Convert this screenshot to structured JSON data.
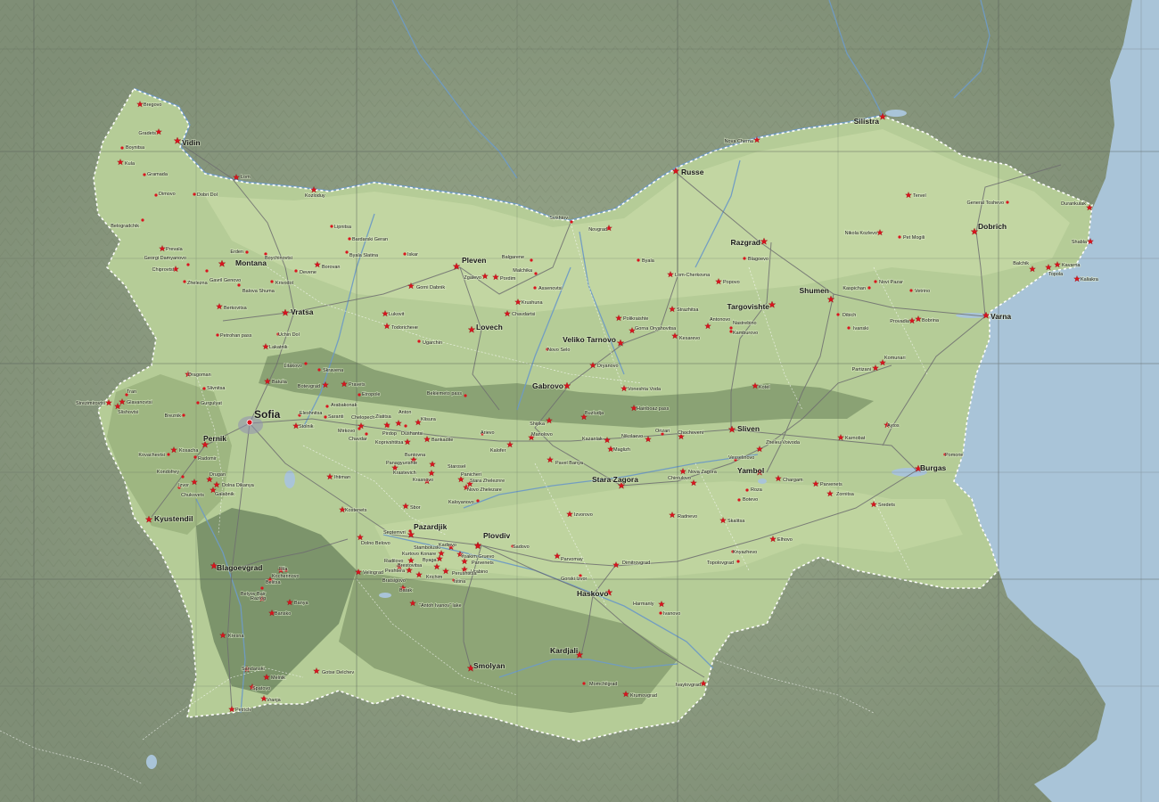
{
  "map": {
    "colors": {
      "sea": "#a9c4d8",
      "land_outside": "#8d9a82",
      "country_lowland": "#b9cf9c",
      "country_mid": "#a9c28a",
      "country_hill": "#93ad78",
      "mountain": "#7c9468",
      "river": "#6f9bc4",
      "road": "#6e6e70",
      "border": "#ffffff",
      "grid": "#555555",
      "star": "#d9141e"
    },
    "places": [
      {
        "name": "Bregovo",
        "kind": "marker"
      },
      {
        "name": "Gradets",
        "kind": "marker"
      },
      {
        "name": "Vidin",
        "kind": "city"
      },
      {
        "name": "Boynitsa",
        "kind": "dot"
      },
      {
        "name": "Kula",
        "kind": "marker"
      },
      {
        "name": "Gramada",
        "kind": "dot"
      },
      {
        "name": "Dimovo",
        "kind": "dot"
      },
      {
        "name": "Dobri Dol",
        "kind": "dot"
      },
      {
        "name": "Lom",
        "kind": "marker"
      },
      {
        "name": "Kozloduy",
        "kind": "marker"
      },
      {
        "name": "Belogradchik",
        "kind": "dot"
      },
      {
        "name": "Lipnitsa",
        "kind": "dot"
      },
      {
        "name": "Bardarski Geran",
        "kind": "dot"
      },
      {
        "name": "Prevala",
        "kind": "marker"
      },
      {
        "name": "Erden",
        "kind": "dot"
      },
      {
        "name": "Boychinovtsi",
        "kind": "dot"
      },
      {
        "name": "Byala Slatina",
        "kind": "dot"
      },
      {
        "name": "Iskar",
        "kind": "dot"
      },
      {
        "name": "Chiprovtsi",
        "kind": "marker"
      },
      {
        "name": "Georgi Damyanovo",
        "kind": "dot"
      },
      {
        "name": "Zheleznа",
        "kind": "dot"
      },
      {
        "name": "Gavril Genovo",
        "kind": "dot"
      },
      {
        "name": "Montana",
        "kind": "city"
      },
      {
        "name": "Balova Shuma",
        "kind": "dot"
      },
      {
        "name": "Krivodol",
        "kind": "dot"
      },
      {
        "name": "Devene",
        "kind": "dot"
      },
      {
        "name": "Borovan",
        "kind": "marker"
      },
      {
        "name": "Gorni Dabnik",
        "kind": "marker"
      },
      {
        "name": "Pleven",
        "kind": "city"
      },
      {
        "name": "Balgarene",
        "kind": "dot"
      },
      {
        "name": "Malchika",
        "kind": "dot"
      },
      {
        "name": "Zgalevo",
        "kind": "marker"
      },
      {
        "name": "Pordim",
        "kind": "marker"
      },
      {
        "name": "Assenovtsi",
        "kind": "dot"
      },
      {
        "name": "Berkovitsa",
        "kind": "marker"
      },
      {
        "name": "Vratsa",
        "kind": "city"
      },
      {
        "name": "Petrohan pass",
        "kind": "dot"
      },
      {
        "name": "Lukovit",
        "kind": "marker"
      },
      {
        "name": "Todoricheне",
        "kind": "marker"
      },
      {
        "name": "Krushuna",
        "kind": "marker"
      },
      {
        "name": "Chavdartsi",
        "kind": "marker"
      },
      {
        "name": "Lovech",
        "kind": "city"
      },
      {
        "name": "Lakatnik",
        "kind": "marker"
      },
      {
        "name": "Uchin Dol",
        "kind": "dot"
      },
      {
        "name": "Ugarchin",
        "kind": "dot"
      },
      {
        "name": "Svishtov",
        "kind": "dot"
      },
      {
        "name": "Novgrad",
        "kind": "marker"
      },
      {
        "name": "Byala",
        "kind": "dot"
      },
      {
        "name": "Russe",
        "kind": "city"
      },
      {
        "name": "Nova Cherna",
        "kind": "marker"
      },
      {
        "name": "Silistra",
        "kind": "city"
      },
      {
        "name": "Tervel",
        "kind": "marker"
      },
      {
        "name": "General Toshevo",
        "kind": "dot"
      },
      {
        "name": "Durankulak",
        "kind": "marker"
      },
      {
        "name": "Dobrich",
        "kind": "city"
      },
      {
        "name": "Nikola Kozlevo",
        "kind": "marker"
      },
      {
        "name": "Pet Mogili",
        "kind": "dot"
      },
      {
        "name": "Shabla",
        "kind": "marker"
      },
      {
        "name": "Razgrad",
        "kind": "city"
      },
      {
        "name": "Blagoevo",
        "kind": "dot"
      },
      {
        "name": "Lom-Cherkovna",
        "kind": "marker"
      },
      {
        "name": "Popovo",
        "kind": "marker"
      },
      {
        "name": "Kaspichan",
        "kind": "dot"
      },
      {
        "name": "Novi Pazar",
        "kind": "dot"
      },
      {
        "name": "Vetrino",
        "kind": "dot"
      },
      {
        "name": "Balchik",
        "kind": "marker"
      },
      {
        "name": "Kavarna",
        "kind": "marker"
      },
      {
        "name": "Topola",
        "kind": "marker"
      },
      {
        "name": "Kaliakra",
        "kind": "marker"
      },
      {
        "name": "Shumen",
        "kind": "city"
      },
      {
        "name": "Targovishte",
        "kind": "city"
      },
      {
        "name": "Strazhitsa",
        "kind": "marker"
      },
      {
        "name": "Polikraishte",
        "kind": "marker"
      },
      {
        "name": "Gorna Oryahovitsa",
        "kind": "marker"
      },
      {
        "name": "Antonovo",
        "kind": "marker"
      },
      {
        "name": "Kamburovo",
        "kind": "dot"
      },
      {
        "name": "Nastrebino",
        "kind": "dot"
      },
      {
        "name": "Kesarevo",
        "kind": "marker"
      },
      {
        "name": "Dibich",
        "kind": "dot"
      },
      {
        "name": "Ivanski",
        "kind": "dot"
      },
      {
        "name": "Provadia",
        "kind": "marker"
      },
      {
        "name": "Bobrina",
        "kind": "marker"
      },
      {
        "name": "Varna",
        "kind": "city"
      },
      {
        "name": "Novo Selo",
        "kind": "dot"
      },
      {
        "name": "Veliko Tarnovo",
        "kind": "city"
      },
      {
        "name": "Dryanovo",
        "kind": "marker"
      },
      {
        "name": "Partizani",
        "kind": "marker"
      },
      {
        "name": "Komunari",
        "kind": "marker"
      },
      {
        "name": "Dragoman",
        "kind": "marker"
      },
      {
        "name": "Slivnitsa",
        "kind": "dot"
      },
      {
        "name": "Etropole",
        "kind": "dot"
      },
      {
        "name": "Skravena",
        "kind": "dot"
      },
      {
        "name": "Litakovo",
        "kind": "dot"
      },
      {
        "name": "Batulia",
        "kind": "marker"
      },
      {
        "name": "Botevgrad",
        "kind": "marker"
      },
      {
        "name": "Pravets",
        "kind": "marker"
      },
      {
        "name": "Beklemeto pass",
        "kind": "dot"
      },
      {
        "name": "Gabrovo",
        "kind": "city"
      },
      {
        "name": "Voneshta Voda",
        "kind": "marker"
      },
      {
        "name": "Kotel",
        "kind": "marker"
      },
      {
        "name": "Strezimirovtsi",
        "kind": "marker"
      },
      {
        "name": "Tran",
        "kind": "dot"
      },
      {
        "name": "Glavanovtsi",
        "kind": "marker"
      },
      {
        "name": "Slishovtsi",
        "kind": "marker"
      },
      {
        "name": "Gurgulyat",
        "kind": "dot"
      },
      {
        "name": "Breznik",
        "kind": "dot"
      },
      {
        "name": "Sofia",
        "kind": "capital"
      },
      {
        "name": "Elеshnitsa",
        "kind": "dot"
      },
      {
        "name": "Arabakonak",
        "kind": "dot"
      },
      {
        "name": "Saranti",
        "kind": "dot"
      },
      {
        "name": "Stolnik",
        "kind": "marker"
      },
      {
        "name": "Chelopech",
        "kind": "marker"
      },
      {
        "name": "Zlatitsa",
        "kind": "marker"
      },
      {
        "name": "Anton",
        "kind": "marker"
      },
      {
        "name": "Klisura",
        "kind": "marker"
      },
      {
        "name": "Mirkovo",
        "kind": "dot"
      },
      {
        "name": "Chavdar",
        "kind": "dot"
      },
      {
        "name": "Pirdop",
        "kind": "dot"
      },
      {
        "name": "Dushantsi",
        "kind": "dot"
      },
      {
        "name": "Koprivshtitsa",
        "kind": "marker"
      },
      {
        "name": "Barikadite",
        "kind": "marker"
      },
      {
        "name": "Arievo",
        "kind": "dot"
      },
      {
        "name": "Kalofer",
        "kind": "marker"
      },
      {
        "name": "Manolovo",
        "kind": "marker"
      },
      {
        "name": "Shipka",
        "kind": "marker"
      },
      {
        "name": "Buzludja",
        "kind": "marker"
      },
      {
        "name": "Hainboaz pass",
        "kind": "marker"
      },
      {
        "name": "Kazanlak",
        "kind": "marker"
      },
      {
        "name": "Maglizh",
        "kind": "marker"
      },
      {
        "name": "Nikolaevo",
        "kind": "marker"
      },
      {
        "name": "Orizari",
        "kind": "dot"
      },
      {
        "name": "Chochoveni",
        "kind": "marker"
      },
      {
        "name": "Sliven",
        "kind": "city"
      },
      {
        "name": "Pavel Banya",
        "kind": "marker"
      },
      {
        "name": "Karnobat",
        "kind": "marker"
      },
      {
        "name": "Aytos",
        "kind": "marker"
      },
      {
        "name": "Pernik",
        "kind": "city"
      },
      {
        "name": "Kosacha",
        "kind": "marker"
      },
      {
        "name": "Radomir",
        "kind": "dot"
      },
      {
        "name": "Kovachevtsi",
        "kind": "dot"
      },
      {
        "name": "Drugan",
        "kind": "marker"
      },
      {
        "name": "Kondofrey",
        "kind": "dot"
      },
      {
        "name": "Dolna Dikanya",
        "kind": "marker"
      },
      {
        "name": "Izvor",
        "kind": "marker"
      },
      {
        "name": "Galabnik",
        "kind": "marker"
      },
      {
        "name": "Chukovets",
        "kind": "dot"
      },
      {
        "name": "Buntovna",
        "kind": "marker"
      },
      {
        "name": "Panagyurishte",
        "kind": "marker"
      },
      {
        "name": "Staroseł",
        "kind": "marker"
      },
      {
        "name": "Krastevich",
        "kind": "marker"
      },
      {
        "name": "Panicheri",
        "kind": "marker"
      },
      {
        "name": "Krasnovo",
        "kind": "marker"
      },
      {
        "name": "Stara Zheleznre",
        "kind": "marker"
      },
      {
        "name": "Novo Zhelezare",
        "kind": "marker"
      },
      {
        "name": "Ihtiman",
        "kind": "marker"
      },
      {
        "name": "Kaloyanovo",
        "kind": "dot"
      },
      {
        "name": "Kostenets",
        "kind": "marker"
      },
      {
        "name": "Sbor",
        "kind": "marker"
      },
      {
        "name": "Stara Zagora",
        "kind": "city"
      },
      {
        "name": "Chintulovo",
        "kind": "marker"
      },
      {
        "name": "Zheleu Voivoda",
        "kind": "marker"
      },
      {
        "name": "Vesselinovo",
        "kind": "dot"
      },
      {
        "name": "Nova Zagora",
        "kind": "marker"
      },
      {
        "name": "Yambol",
        "kind": "city"
      },
      {
        "name": "Chargam",
        "kind": "marker"
      },
      {
        "name": "Parvenets",
        "kind": "marker"
      },
      {
        "name": "Burgas",
        "kind": "city"
      },
      {
        "name": "Pomorie",
        "kind": "dot"
      },
      {
        "name": "Roza",
        "kind": "dot"
      },
      {
        "name": "Botevo",
        "kind": "dot"
      },
      {
        "name": "Zornitsa",
        "kind": "marker"
      },
      {
        "name": "Sredets",
        "kind": "marker"
      },
      {
        "name": "Kyustendil",
        "kind": "city"
      },
      {
        "name": "Izvorovo",
        "kind": "marker"
      },
      {
        "name": "Radnevo",
        "kind": "marker"
      },
      {
        "name": "Skalitsa",
        "kind": "marker"
      },
      {
        "name": "Septemvri",
        "kind": "dot"
      },
      {
        "name": "Pazardjik",
        "kind": "city"
      },
      {
        "name": "Dolno Belovo",
        "kind": "marker"
      },
      {
        "name": "Plovdiv",
        "kind": "city"
      },
      {
        "name": "Stamboluski",
        "kind": "marker"
      },
      {
        "name": "Kadievo",
        "kind": "marker"
      },
      {
        "name": "Sadovo",
        "kind": "dot"
      },
      {
        "name": "Kurtovo Konare",
        "kind": "marker"
      },
      {
        "name": "Yoakim Gruevo",
        "kind": "marker"
      },
      {
        "name": "Radilovo",
        "kind": "marker"
      },
      {
        "name": "Byaga",
        "kind": "marker"
      },
      {
        "name": "Parvenets",
        "kind": "marker"
      },
      {
        "name": "Peshtera",
        "kind": "marker"
      },
      {
        "name": "Hrabino",
        "kind": "marker"
      },
      {
        "name": "Krichim",
        "kind": "marker"
      },
      {
        "name": "Perushtitsa",
        "kind": "marker"
      },
      {
        "name": "Bratsigovo",
        "kind": "marker"
      },
      {
        "name": "Brestovitsa",
        "kind": "marker"
      },
      {
        "name": "Istina",
        "kind": "dot"
      },
      {
        "name": "Batak",
        "kind": "marker"
      },
      {
        "name": "Velingrad",
        "kind": "marker"
      },
      {
        "name": "\"Antoh Ivanov\" lake",
        "kind": "marker"
      },
      {
        "name": "Parvomay",
        "kind": "marker"
      },
      {
        "name": "Dimitrovgrad",
        "kind": "marker"
      },
      {
        "name": "Gorski Izvor",
        "kind": "dot"
      },
      {
        "name": "Topolovgrad",
        "kind": "dot"
      },
      {
        "name": "Knyazhevo",
        "kind": "dot"
      },
      {
        "name": "Elhovo",
        "kind": "marker"
      },
      {
        "name": "Blagoevgrad",
        "kind": "city"
      },
      {
        "name": "Rila",
        "kind": "marker"
      },
      {
        "name": "Kocherinovo",
        "kind": "dot"
      },
      {
        "name": "Belitsa",
        "kind": "marker"
      },
      {
        "name": "Belyov Bair",
        "kind": "dot"
      },
      {
        "name": "Razlog",
        "kind": "marker"
      },
      {
        "name": "Banya",
        "kind": "marker"
      },
      {
        "name": "Bansko",
        "kind": "marker"
      },
      {
        "name": "Haskovo",
        "kind": "city"
      },
      {
        "name": "Harmanly",
        "kind": "marker"
      },
      {
        "name": "Ivanovo",
        "kind": "dot"
      },
      {
        "name": "Kresna",
        "kind": "marker"
      },
      {
        "name": "Kardjali",
        "kind": "city"
      },
      {
        "name": "Smolyan",
        "kind": "city"
      },
      {
        "name": "Sandanski",
        "kind": "marker"
      },
      {
        "name": "Melnik",
        "kind": "marker"
      },
      {
        "name": "Gotse Delchev",
        "kind": "marker"
      },
      {
        "name": "Spatovo",
        "kind": "marker"
      },
      {
        "name": "Vranja",
        "kind": "marker"
      },
      {
        "name": "Petrich",
        "kind": "marker"
      },
      {
        "name": "Momchilgrad",
        "kind": "dot"
      },
      {
        "name": "Krumovgrad",
        "kind": "marker"
      },
      {
        "name": "Ivaylovgrad",
        "kind": "marker"
      }
    ]
  }
}
